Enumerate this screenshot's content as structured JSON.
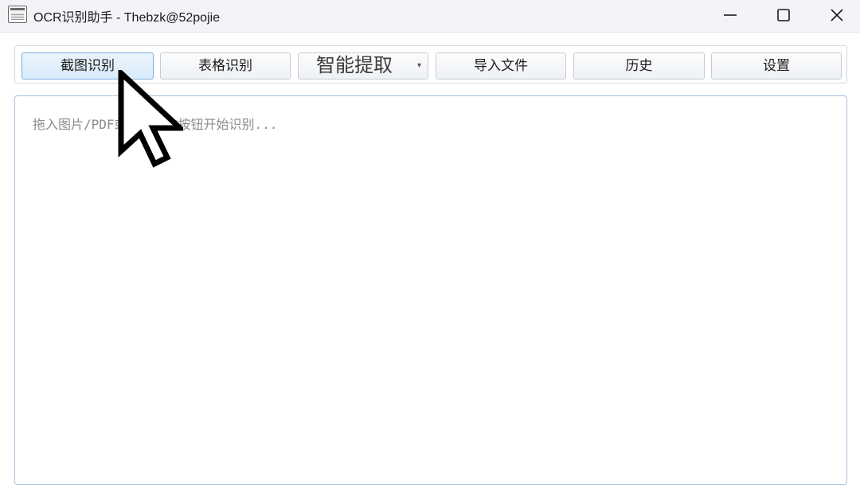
{
  "window": {
    "title": "OCR识别助手 - Thebzk@52pojie",
    "app_icon": "scanner-app-icon",
    "controls": {
      "minimize_icon": "minimize-icon",
      "maximize_icon": "maximize-icon",
      "close_icon": "close-icon"
    }
  },
  "toolbar": {
    "buttons": [
      {
        "label": "截图识别",
        "active": true
      },
      {
        "label": "表格识别"
      },
      {
        "label": "智能提取",
        "has_dropdown": true
      },
      {
        "label": "导入文件"
      },
      {
        "label": "历史"
      },
      {
        "label": "设置"
      }
    ]
  },
  "result": {
    "placeholder": "拖入图片/PDF或点击上方按钮开始识别...",
    "value": ""
  },
  "pointer": {
    "icon": "mouse-pointer-icon"
  },
  "colors": {
    "titlebar_bg": "#f2f4f8",
    "active_button_border": "#7eaee0",
    "textarea_border": "#a9c3d8"
  }
}
